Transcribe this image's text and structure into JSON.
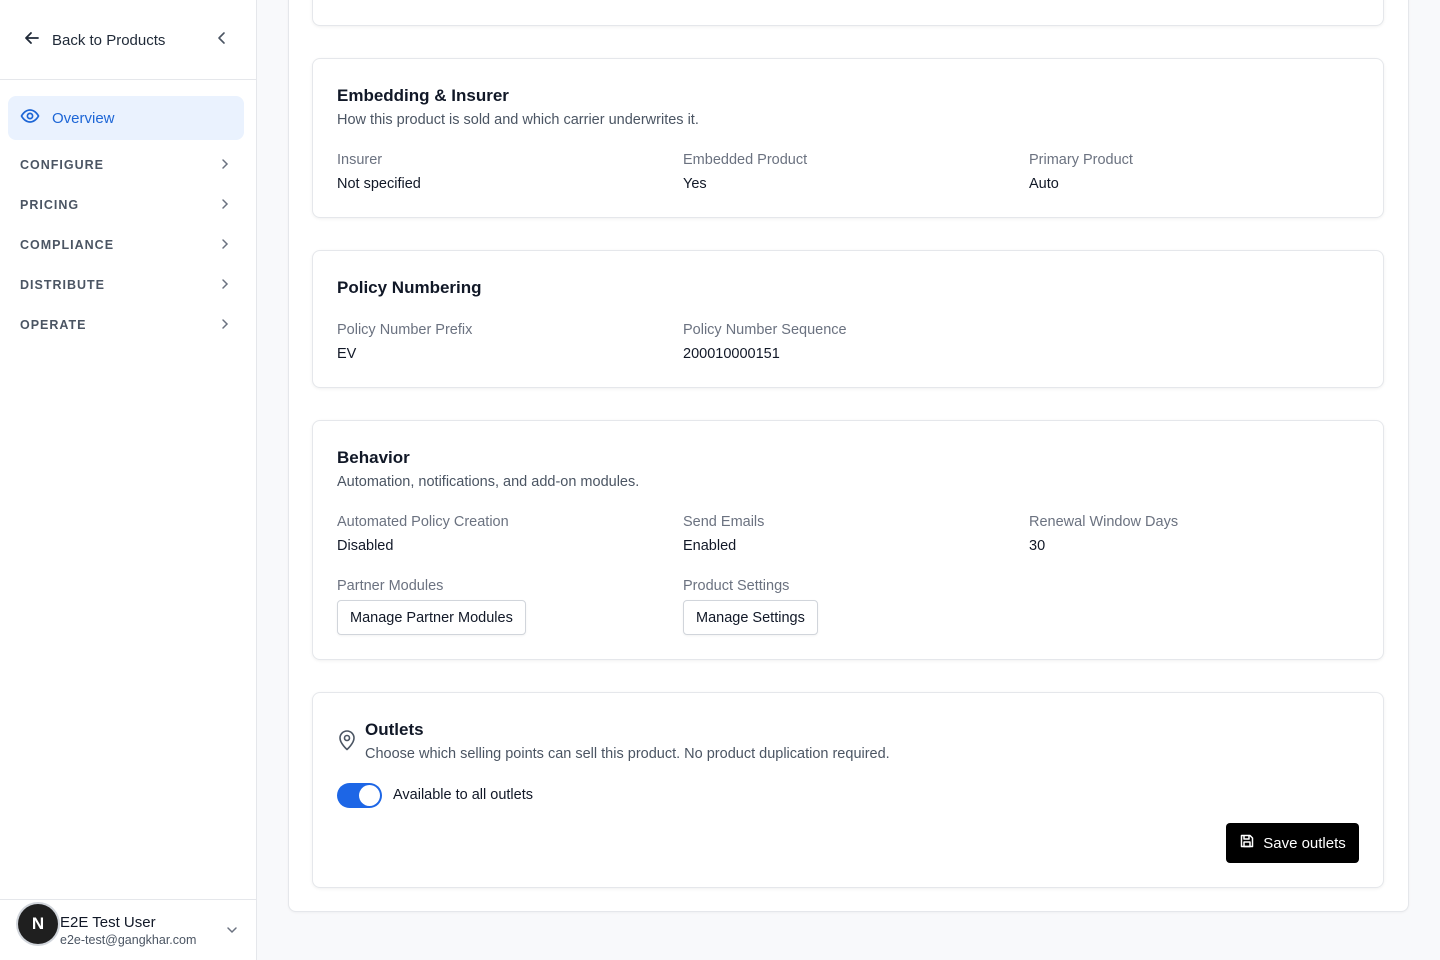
{
  "sidebar": {
    "back_label": "Back to Products",
    "overview_label": "Overview",
    "sections": [
      {
        "label": "CONFIGURE"
      },
      {
        "label": "PRICING"
      },
      {
        "label": "COMPLIANCE"
      },
      {
        "label": "DISTRIBUTE"
      },
      {
        "label": "OPERATE"
      }
    ],
    "user": {
      "initial": "N",
      "name": "E2E Test User",
      "email": "e2e-test@gangkhar.com"
    }
  },
  "embedding": {
    "title": "Embedding & Insurer",
    "description": "How this product is sold and which carrier underwrites it.",
    "fields": [
      {
        "label": "Insurer",
        "value": "Not specified"
      },
      {
        "label": "Embedded Product",
        "value": "Yes"
      },
      {
        "label": "Primary Product",
        "value": "Auto"
      }
    ]
  },
  "numbering": {
    "title": "Policy Numbering",
    "fields": [
      {
        "label": "Policy Number Prefix",
        "value": "EV"
      },
      {
        "label": "Policy Number Sequence",
        "value": "200010000151"
      }
    ]
  },
  "behavior": {
    "title": "Behavior",
    "description": "Automation, notifications, and add-on modules.",
    "fields": [
      {
        "label": "Automated Policy Creation",
        "value": "Disabled"
      },
      {
        "label": "Send Emails",
        "value": "Enabled"
      },
      {
        "label": "Renewal Window Days",
        "value": "30"
      }
    ],
    "partner_modules_label": "Partner Modules",
    "partner_modules_button": "Manage Partner Modules",
    "product_settings_label": "Product Settings",
    "product_settings_button": "Manage Settings"
  },
  "outlets": {
    "title": "Outlets",
    "description": "Choose which selling points can sell this product. No product duplication required.",
    "toggle_label": "Available to all outlets",
    "toggle_on": true,
    "save_label": "Save outlets"
  },
  "colors": {
    "accent": "#1d66e6",
    "overview_bg": "#eaf2fe"
  }
}
